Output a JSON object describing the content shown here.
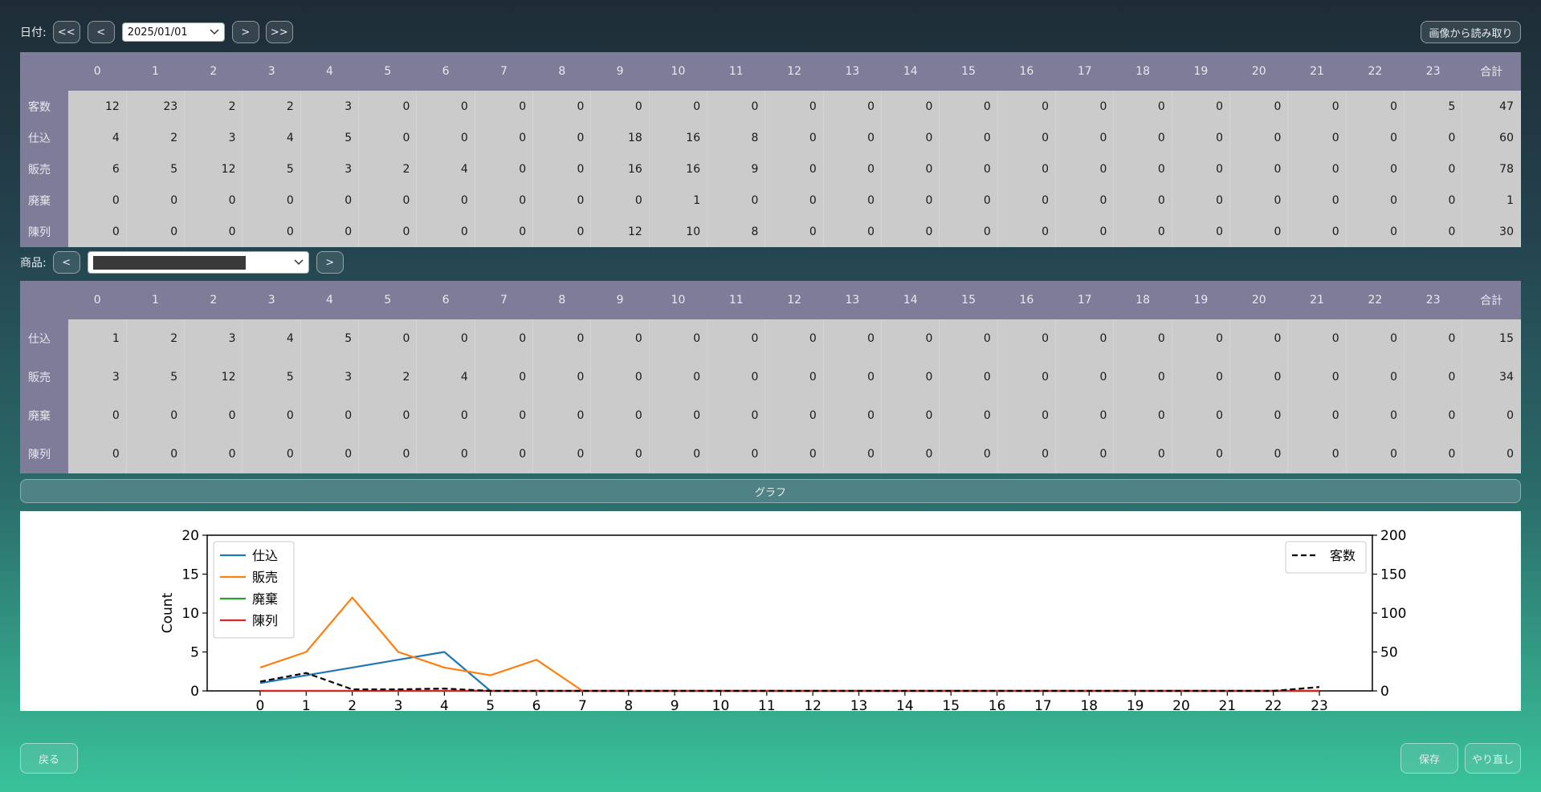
{
  "top_bar": {
    "date_label": "日付:",
    "first_label": "<<",
    "prev_label": "<",
    "date_value": "2025/01/01",
    "next_label": ">",
    "last_label": ">>",
    "read_image_label": "画像から読み取り"
  },
  "hours_header": [
    "0",
    "1",
    "2",
    "3",
    "4",
    "5",
    "6",
    "7",
    "8",
    "9",
    "10",
    "11",
    "12",
    "13",
    "14",
    "15",
    "16",
    "17",
    "18",
    "19",
    "20",
    "21",
    "22",
    "23",
    "合計"
  ],
  "daily_table": {
    "rows": [
      {
        "label": "客数",
        "values": [
          12,
          23,
          2,
          2,
          3,
          0,
          0,
          0,
          0,
          0,
          0,
          0,
          0,
          0,
          0,
          0,
          0,
          0,
          0,
          0,
          0,
          0,
          0,
          5,
          47
        ]
      },
      {
        "label": "仕込",
        "values": [
          4,
          2,
          3,
          4,
          5,
          0,
          0,
          0,
          0,
          18,
          16,
          8,
          0,
          0,
          0,
          0,
          0,
          0,
          0,
          0,
          0,
          0,
          0,
          0,
          60
        ]
      },
      {
        "label": "販売",
        "values": [
          6,
          5,
          12,
          5,
          3,
          2,
          4,
          0,
          0,
          16,
          16,
          9,
          0,
          0,
          0,
          0,
          0,
          0,
          0,
          0,
          0,
          0,
          0,
          0,
          78
        ]
      },
      {
        "label": "廃棄",
        "values": [
          0,
          0,
          0,
          0,
          0,
          0,
          0,
          0,
          0,
          0,
          1,
          0,
          0,
          0,
          0,
          0,
          0,
          0,
          0,
          0,
          0,
          0,
          0,
          0,
          1
        ]
      },
      {
        "label": "陳列",
        "values": [
          0,
          0,
          0,
          0,
          0,
          0,
          0,
          0,
          0,
          12,
          10,
          8,
          0,
          0,
          0,
          0,
          0,
          0,
          0,
          0,
          0,
          0,
          0,
          0,
          30
        ]
      }
    ]
  },
  "product_bar": {
    "label": "商品:",
    "prev_label": "<",
    "next_label": ">",
    "selected_value": "",
    "dropdown_icon": "chevron-down-icon"
  },
  "product_table": {
    "rows": [
      {
        "label": "仕込",
        "values": [
          1,
          2,
          3,
          4,
          5,
          0,
          0,
          0,
          0,
          0,
          0,
          0,
          0,
          0,
          0,
          0,
          0,
          0,
          0,
          0,
          0,
          0,
          0,
          0,
          15
        ]
      },
      {
        "label": "販売",
        "values": [
          3,
          5,
          12,
          5,
          3,
          2,
          4,
          0,
          0,
          0,
          0,
          0,
          0,
          0,
          0,
          0,
          0,
          0,
          0,
          0,
          0,
          0,
          0,
          0,
          34
        ]
      },
      {
        "label": "廃棄",
        "values": [
          0,
          0,
          0,
          0,
          0,
          0,
          0,
          0,
          0,
          0,
          0,
          0,
          0,
          0,
          0,
          0,
          0,
          0,
          0,
          0,
          0,
          0,
          0,
          0,
          0
        ]
      },
      {
        "label": "陳列",
        "values": [
          0,
          0,
          0,
          0,
          0,
          0,
          0,
          0,
          0,
          0,
          0,
          0,
          0,
          0,
          0,
          0,
          0,
          0,
          0,
          0,
          0,
          0,
          0,
          0,
          0
        ]
      }
    ]
  },
  "graph_button_label": "グラフ",
  "chart_data": {
    "type": "line",
    "x": [
      0,
      1,
      2,
      3,
      4,
      5,
      6,
      7,
      8,
      9,
      10,
      11,
      12,
      13,
      14,
      15,
      16,
      17,
      18,
      19,
      20,
      21,
      22,
      23
    ],
    "ylabel": "Count",
    "ylim": [
      0,
      20
    ],
    "y_ticks": [
      0,
      5,
      10,
      15,
      20
    ],
    "y2lim": [
      0,
      200
    ],
    "y2_ticks": [
      0,
      50,
      100,
      150,
      200
    ],
    "grid": false,
    "series": [
      {
        "name": "仕込",
        "color": "#1f77b4",
        "axis": "left",
        "dashed": false,
        "values": [
          1,
          2,
          3,
          4,
          5,
          0,
          0,
          0,
          0,
          0,
          0,
          0,
          0,
          0,
          0,
          0,
          0,
          0,
          0,
          0,
          0,
          0,
          0,
          0
        ]
      },
      {
        "name": "販売",
        "color": "#ff7f0e",
        "axis": "left",
        "dashed": false,
        "values": [
          3,
          5,
          12,
          5,
          3,
          2,
          4,
          0,
          0,
          0,
          0,
          0,
          0,
          0,
          0,
          0,
          0,
          0,
          0,
          0,
          0,
          0,
          0,
          0
        ]
      },
      {
        "name": "廃棄",
        "color": "#2ca02c",
        "axis": "left",
        "dashed": false,
        "values": [
          0,
          0,
          0,
          0,
          0,
          0,
          0,
          0,
          0,
          0,
          0,
          0,
          0,
          0,
          0,
          0,
          0,
          0,
          0,
          0,
          0,
          0,
          0,
          0
        ]
      },
      {
        "name": "陳列",
        "color": "#d62728",
        "axis": "left",
        "dashed": false,
        "values": [
          0,
          0,
          0,
          0,
          0,
          0,
          0,
          0,
          0,
          0,
          0,
          0,
          0,
          0,
          0,
          0,
          0,
          0,
          0,
          0,
          0,
          0,
          0,
          0
        ]
      },
      {
        "name": "客数",
        "color": "#000000",
        "axis": "right",
        "dashed": true,
        "values": [
          12,
          23,
          2,
          2,
          3,
          0,
          0,
          0,
          0,
          0,
          0,
          0,
          0,
          0,
          0,
          0,
          0,
          0,
          0,
          0,
          0,
          0,
          0,
          5
        ]
      }
    ],
    "legend_left_placement": "top-left",
    "legend_right_placement": "top-right"
  },
  "bottom_bar": {
    "back_label": "戻る",
    "save_label": "保存",
    "redo_label": "やり直し"
  }
}
